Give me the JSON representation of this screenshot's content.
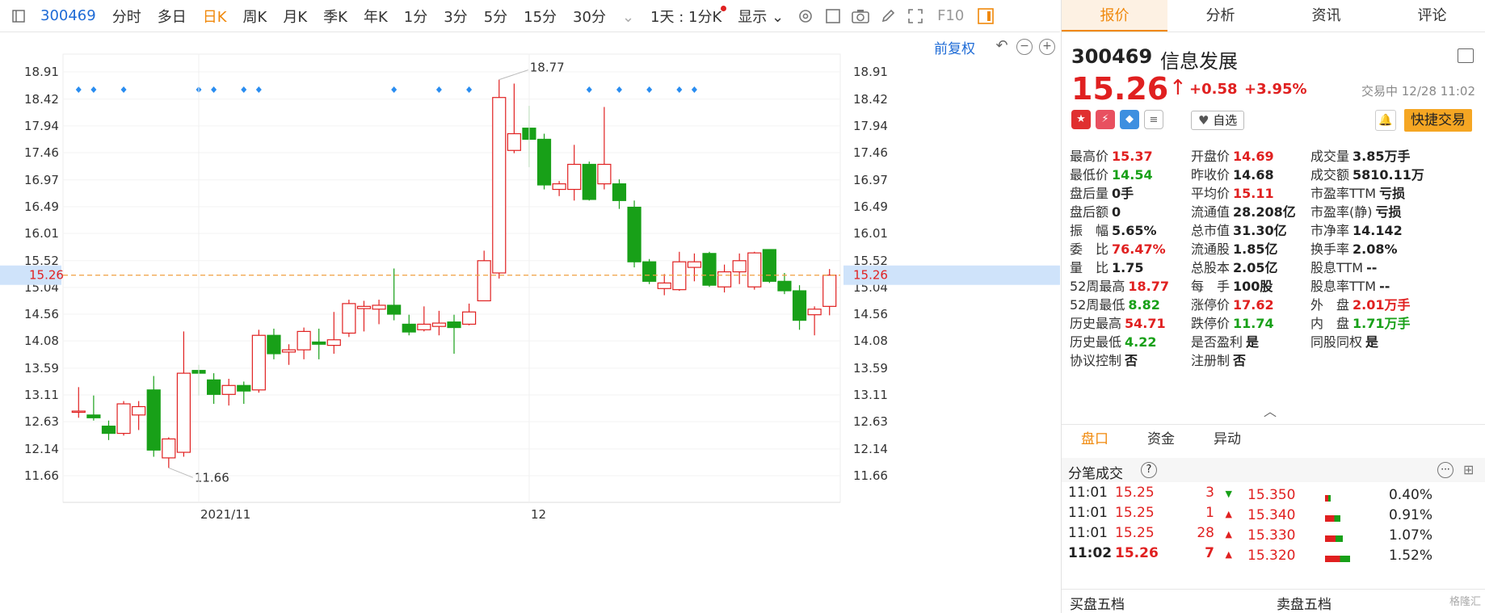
{
  "toolbar": {
    "code": "300469",
    "periods": [
      "分时",
      "多日",
      "日K",
      "周K",
      "月K",
      "季K",
      "年K",
      "1分",
      "3分",
      "5分",
      "15分",
      "30分"
    ],
    "active": "日K",
    "interval": "1天 : 1分K",
    "display": "显示",
    "f10": "F10"
  },
  "chart_ctrl": {
    "restore": "前复权"
  },
  "panel": {
    "tabs": [
      "报价",
      "分析",
      "资讯",
      "评论"
    ],
    "active_tab": "报价",
    "code": "300469",
    "name": "信息发展",
    "price": "15.26",
    "change": "+0.58",
    "pct": "+3.95%",
    "status": "交易中 12/28 11:02",
    "zixuan": "自选",
    "quick_trade": "快捷交易",
    "stats": [
      [
        [
          "最高价",
          "15.37",
          "up"
        ],
        [
          "开盘价",
          "14.69",
          "up"
        ],
        [
          "成交量",
          "3.85万手",
          "nt"
        ]
      ],
      [
        [
          "最低价",
          "14.54",
          "dn"
        ],
        [
          "昨收价",
          "14.68",
          "nt"
        ],
        [
          "成交额",
          "5810.11万",
          "nt"
        ]
      ],
      [
        [
          "盘后量",
          "0手",
          "nt"
        ],
        [
          "平均价",
          "15.11",
          "up"
        ],
        [
          "市盈率TTM",
          "亏损",
          "nt"
        ]
      ],
      [
        [
          "盘后额",
          "0",
          "nt"
        ],
        [
          "流通值",
          "28.208亿",
          "nt"
        ],
        [
          "市盈率(静)",
          "亏损",
          "nt"
        ]
      ],
      [
        [
          "振　幅",
          "5.65%",
          "nt"
        ],
        [
          "总市值",
          "31.30亿",
          "nt"
        ],
        [
          "市净率",
          "14.142",
          "nt"
        ]
      ],
      [
        [
          "委　比",
          "76.47%",
          "up"
        ],
        [
          "流通股",
          "1.85亿",
          "nt"
        ],
        [
          "换手率",
          "2.08%",
          "nt"
        ]
      ],
      [
        [
          "量　比",
          "1.75",
          "nt"
        ],
        [
          "总股本",
          "2.05亿",
          "nt"
        ],
        [
          "股息TTM",
          "--",
          "nt"
        ]
      ],
      [
        [
          "52周最高",
          "18.77",
          "up"
        ],
        [
          "每　手",
          "100股",
          "nt"
        ],
        [
          "股息率TTM",
          "--",
          "nt"
        ]
      ],
      [
        [
          "52周最低",
          "8.82",
          "dn"
        ],
        [
          "涨停价",
          "17.62",
          "up"
        ],
        [
          "外　盘",
          "2.01万手",
          "up"
        ]
      ],
      [
        [
          "历史最高",
          "54.71",
          "up"
        ],
        [
          "跌停价",
          "11.74",
          "dn"
        ],
        [
          "内　盘",
          "1.71万手",
          "dn"
        ]
      ],
      [
        [
          "历史最低",
          "4.22",
          "dn"
        ],
        [
          "是否盈利",
          "是",
          "nt"
        ],
        [
          "同股同权",
          "是",
          "nt"
        ]
      ],
      [
        [
          "协议控制",
          "否",
          "nt"
        ],
        [
          "注册制",
          "否",
          "nt"
        ]
      ]
    ],
    "pk_tabs": [
      "盘口",
      "资金",
      "异动"
    ],
    "tick_title": "分笔成交",
    "ticks": [
      {
        "time": "11:01",
        "price": "15.25",
        "vol": "3",
        "dir": "dn"
      },
      {
        "time": "11:01",
        "price": "15.25",
        "vol": "1",
        "dir": "up"
      },
      {
        "time": "11:01",
        "price": "15.25",
        "vol": "28",
        "dir": "up"
      },
      {
        "time": "11:02",
        "price": "15.26",
        "vol": "7",
        "dir": "up"
      }
    ],
    "depth": [
      {
        "price": "15.350",
        "pct": "0.40%",
        "f": 0.04
      },
      {
        "price": "15.340",
        "pct": "0.91%",
        "f": 0.11
      },
      {
        "price": "15.330",
        "pct": "1.07%",
        "f": 0.13
      },
      {
        "price": "15.320",
        "pct": "1.52%",
        "f": 0.18
      }
    ],
    "buy5": "买盘五档",
    "sell5": "卖盘五档",
    "watermark": "格隆汇"
  },
  "chart_data": {
    "type": "candlestick",
    "y_ticks": [
      "18.91",
      "18.42",
      "17.94",
      "17.46",
      "16.97",
      "16.49",
      "16.01",
      "15.52",
      "15.04",
      "14.56",
      "14.08",
      "13.59",
      "13.11",
      "12.63",
      "12.14",
      "11.66"
    ],
    "current_price": "15.26",
    "max_label": "18.77",
    "min_label": "11.66",
    "x_labels": [
      "2021/11",
      "12"
    ],
    "colors": {
      "up": "#e02020",
      "down": "#18a018",
      "current": "#f0a040"
    },
    "candles": [
      [
        12.82,
        12.82,
        13.25,
        12.7
      ],
      [
        12.75,
        12.7,
        13.1,
        12.65
      ],
      [
        12.55,
        12.42,
        12.65,
        12.3
      ],
      [
        12.42,
        12.95,
        13.0,
        12.38
      ],
      [
        12.75,
        12.9,
        13.0,
        12.48
      ],
      [
        13.2,
        12.12,
        13.45,
        12.0
      ],
      [
        11.98,
        12.32,
        12.35,
        11.8
      ],
      [
        12.08,
        13.5,
        14.25,
        12.0
      ],
      [
        13.55,
        13.5,
        13.65,
        13.1
      ],
      [
        13.38,
        13.12,
        13.5,
        12.95
      ],
      [
        13.12,
        13.28,
        13.4,
        12.92
      ],
      [
        13.28,
        13.18,
        13.35,
        12.95
      ],
      [
        13.2,
        14.18,
        14.28,
        13.15
      ],
      [
        14.18,
        13.85,
        14.3,
        13.75
      ],
      [
        13.88,
        13.92,
        14.02,
        13.65
      ],
      [
        13.92,
        14.25,
        14.32,
        13.75
      ],
      [
        14.06,
        14.02,
        14.3,
        13.75
      ],
      [
        14.0,
        14.1,
        14.6,
        13.85
      ],
      [
        14.22,
        14.75,
        14.82,
        14.15
      ],
      [
        14.66,
        14.7,
        14.8,
        14.25
      ],
      [
        14.65,
        14.72,
        14.82,
        14.38
      ],
      [
        14.72,
        14.56,
        15.38,
        14.45
      ],
      [
        14.38,
        14.24,
        14.55,
        14.18
      ],
      [
        14.28,
        14.38,
        14.7,
        14.25
      ],
      [
        14.34,
        14.4,
        14.62,
        14.18
      ],
      [
        14.42,
        14.32,
        14.55,
        13.85
      ],
      [
        14.38,
        14.6,
        14.75,
        14.36
      ],
      [
        14.8,
        15.52,
        15.7,
        14.8
      ],
      [
        15.3,
        18.45,
        18.77,
        15.2
      ],
      [
        17.5,
        17.8,
        18.7,
        17.45
      ],
      [
        17.9,
        17.7,
        18.3,
        17.2
      ],
      [
        17.7,
        16.88,
        17.8,
        16.8
      ],
      [
        16.8,
        16.9,
        16.95,
        16.68
      ],
      [
        16.8,
        17.25,
        17.6,
        16.6
      ],
      [
        17.25,
        16.62,
        17.3,
        16.6
      ],
      [
        16.9,
        17.25,
        18.28,
        16.8
      ],
      [
        16.9,
        16.6,
        16.98,
        16.45
      ],
      [
        16.48,
        15.5,
        16.6,
        15.4
      ],
      [
        15.5,
        15.15,
        15.55,
        15.1
      ],
      [
        15.02,
        15.12,
        15.28,
        14.9
      ],
      [
        15.0,
        15.5,
        15.68,
        14.98
      ],
      [
        15.4,
        15.5,
        15.65,
        15.15
      ],
      [
        15.65,
        15.08,
        15.68,
        15.05
      ],
      [
        15.05,
        15.32,
        15.45,
        14.95
      ],
      [
        15.32,
        15.52,
        15.65,
        15.1
      ],
      [
        15.05,
        15.66,
        15.68,
        15.0
      ],
      [
        15.72,
        15.15,
        15.72,
        15.12
      ],
      [
        15.15,
        14.98,
        15.3,
        14.92
      ],
      [
        14.98,
        14.45,
        15.08,
        14.28
      ],
      [
        14.55,
        14.65,
        14.7,
        14.18
      ],
      [
        14.7,
        15.26,
        15.37,
        14.54
      ]
    ],
    "markers": [
      0,
      1,
      3,
      8,
      9,
      11,
      12,
      21,
      24,
      26,
      34,
      36,
      38,
      40,
      41
    ]
  }
}
